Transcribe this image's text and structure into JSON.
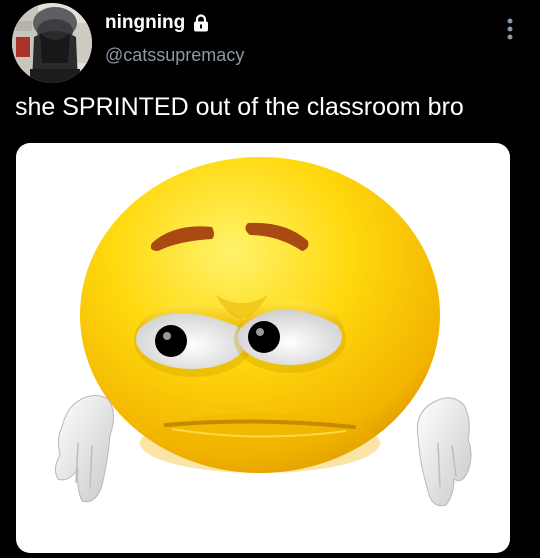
{
  "tweet": {
    "author": {
      "display_name": "ningning",
      "handle": "@catssupremacy",
      "avatar_icon": "profile-photo",
      "badge_icon": "lock-icon"
    },
    "text": "she SPRINTED out of the classroom bro",
    "media": {
      "icon": "sad-emoji-face"
    },
    "more_icon": "more-vertical-icon"
  },
  "colors": {
    "background": "#000000",
    "text": "#ffffff",
    "secondary_text": "#8b98a5"
  }
}
